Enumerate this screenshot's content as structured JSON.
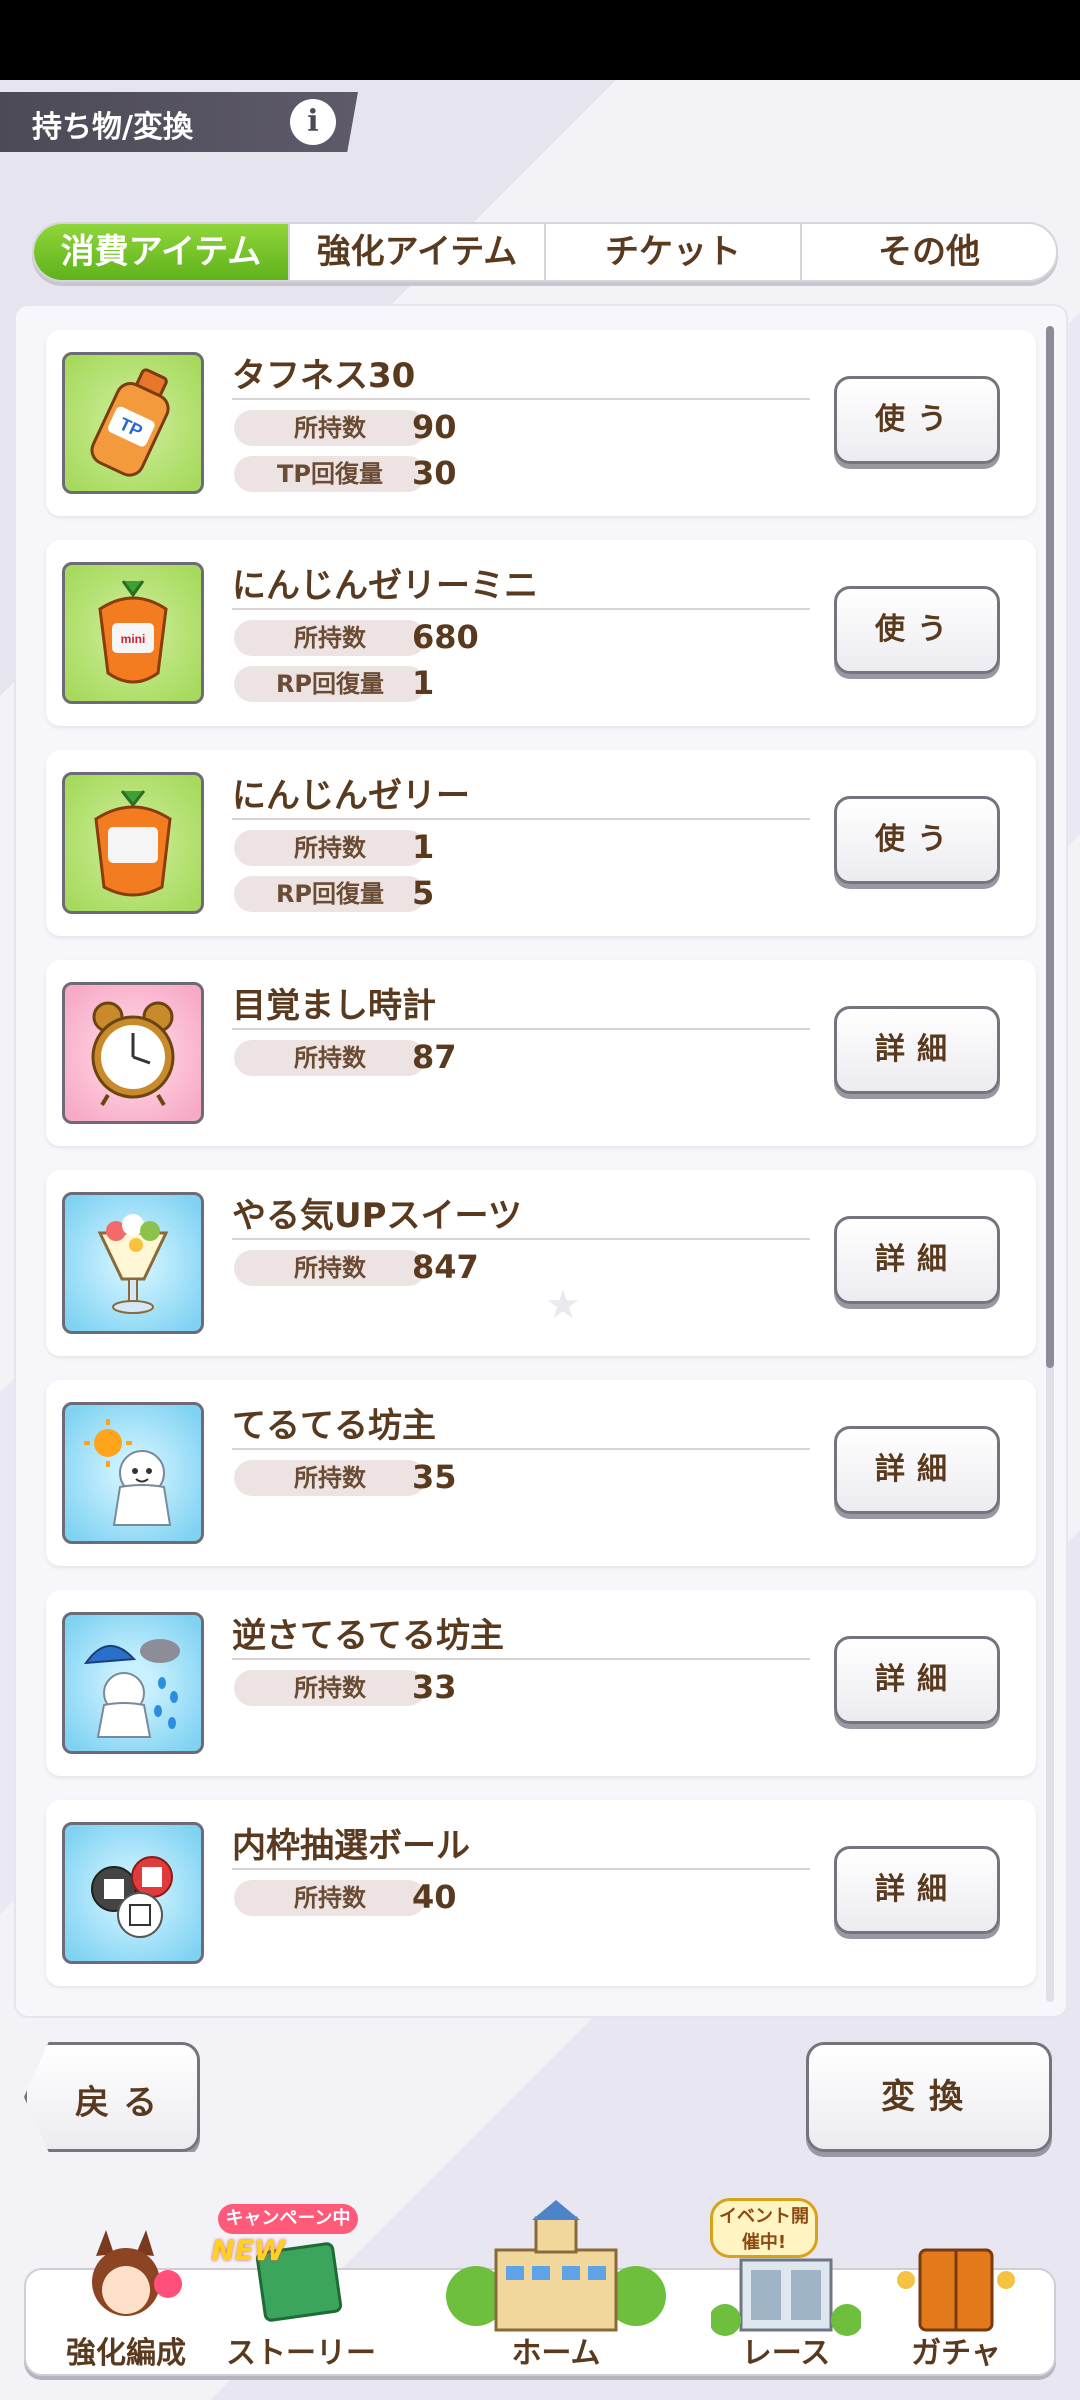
{
  "header": {
    "title": "持ち物/変換",
    "info_label": "i"
  },
  "tabs": [
    {
      "label": "消費アイテム"
    },
    {
      "label": "強化アイテム"
    },
    {
      "label": "チケット"
    },
    {
      "label": "その他"
    }
  ],
  "items": [
    {
      "name": "タフネス30",
      "rows": [
        {
          "label": "所持数",
          "value": "90"
        },
        {
          "label": "TP回復量",
          "value": "30"
        }
      ],
      "button": "使う",
      "icon": "tp-bottle-icon",
      "icon_bg": "green"
    },
    {
      "name": "にんじんゼリーミニ",
      "rows": [
        {
          "label": "所持数",
          "value": "680"
        },
        {
          "label": "RP回復量",
          "value": "1"
        }
      ],
      "button": "使う",
      "icon": "carrot-jelly-mini-icon",
      "icon_bg": "green"
    },
    {
      "name": "にんじんゼリー",
      "rows": [
        {
          "label": "所持数",
          "value": "1"
        },
        {
          "label": "RP回復量",
          "value": "5"
        }
      ],
      "button": "使う",
      "icon": "carrot-jelly-icon",
      "icon_bg": "green"
    },
    {
      "name": "目覚まし時計",
      "rows": [
        {
          "label": "所持数",
          "value": "87"
        }
      ],
      "button": "詳細",
      "icon": "alarm-clock-icon",
      "icon_bg": "pink"
    },
    {
      "name": "やる気UPスイーツ",
      "rows": [
        {
          "label": "所持数",
          "value": "847"
        }
      ],
      "button": "詳細",
      "icon": "parfait-icon",
      "icon_bg": "blue"
    },
    {
      "name": "てるてる坊主",
      "rows": [
        {
          "label": "所持数",
          "value": "35"
        }
      ],
      "button": "詳細",
      "icon": "teru-teru-bozu-sun-icon",
      "icon_bg": "blue"
    },
    {
      "name": "逆さてるてる坊主",
      "rows": [
        {
          "label": "所持数",
          "value": "33"
        }
      ],
      "button": "詳細",
      "icon": "teru-teru-bozu-rain-icon",
      "icon_bg": "blue"
    },
    {
      "name": "内枠抽選ボール",
      "rows": [
        {
          "label": "所持数",
          "value": "40"
        }
      ],
      "button": "詳細",
      "icon": "lottery-balls-icon",
      "icon_bg": "blue"
    }
  ],
  "footer": {
    "back_label": "戻る",
    "convert_label": "変換"
  },
  "bottom_nav": [
    {
      "label": "強化編成",
      "badge": ""
    },
    {
      "label": "ストーリー",
      "badge": "キャンペーン中",
      "badge2": "NEW"
    },
    {
      "label": "ホーム",
      "badge": ""
    },
    {
      "label": "レース",
      "badge": "イベント開催中!"
    },
    {
      "label": "ガチャ",
      "badge": ""
    }
  ],
  "colors": {
    "accent_green": "#6cc024",
    "text_brown": "#5a3a1e"
  }
}
